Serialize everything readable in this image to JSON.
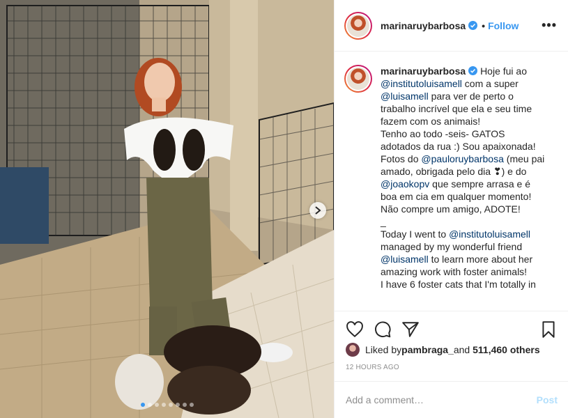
{
  "post": {
    "username": "marinaruybarbosa",
    "follow_label": "Follow",
    "separator": "•",
    "more_label": "•••"
  },
  "caption": {
    "username": "marinaruybarbosa",
    "lines": [
      [
        {
          "t": "Hoje fui ao",
          "m": false
        }
      ],
      [
        {
          "t": "@institutoluisamell",
          "m": true
        },
        {
          "t": " com a super",
          "m": false
        }
      ],
      [
        {
          "t": "@luisamell",
          "m": true
        },
        {
          "t": " para ver de perto o",
          "m": false
        }
      ],
      [
        {
          "t": "trabalho incrível que ela e seu time",
          "m": false
        }
      ],
      [
        {
          "t": "fazem com os animais!",
          "m": false
        }
      ],
      [
        {
          "t": "Tenho ao todo -seis- GATOS",
          "m": false
        }
      ],
      [
        {
          "t": "adotados da rua :) Sou apaixonada!",
          "m": false
        }
      ],
      [
        {
          "t": "Fotos do ",
          "m": false
        },
        {
          "t": "@pauloruybarbosa",
          "m": true
        },
        {
          "t": " (meu pai",
          "m": false
        }
      ],
      [
        {
          "t": "amado, obrigada pelo dia ❣) e do",
          "m": false
        }
      ],
      [
        {
          "t": "@joaokopv",
          "m": true
        },
        {
          "t": " que sempre arrasa e é",
          "m": false
        }
      ],
      [
        {
          "t": "boa em cia em qualquer momento!",
          "m": false
        }
      ],
      [
        {
          "t": "Não compre um amigo, ADOTE!",
          "m": false
        }
      ],
      [
        {
          "t": "_",
          "m": false
        }
      ],
      [
        {
          "t": " ",
          "m": false
        }
      ],
      [
        {
          "t": "Today I went to ",
          "m": false
        },
        {
          "t": "@institutoluisamell",
          "m": true
        }
      ],
      [
        {
          "t": "managed by my wonderful friend",
          "m": false
        }
      ],
      [
        {
          "t": "@luisamell",
          "m": true
        },
        {
          "t": " to learn more about her",
          "m": false
        }
      ],
      [
        {
          "t": "amazing work with foster animals!",
          "m": false
        }
      ],
      [
        {
          "t": "I have 6 foster cats that I'm totally in",
          "m": false
        }
      ]
    ]
  },
  "likes": {
    "prefix": "Liked by ",
    "user": "pambraga_",
    "middle": " and ",
    "count_text": "511,460 others"
  },
  "timestamp": "12 HOURS AGO",
  "comment": {
    "placeholder": "Add a comment…",
    "post_label": "Post"
  },
  "carousel": {
    "total_slides": 8,
    "active_index": 0
  },
  "colors": {
    "accent": "#3897f0",
    "mention": "#003569",
    "muted": "#8e8e8e",
    "post_disabled": "#b2dffc"
  },
  "icons": [
    "heart-icon",
    "comment-icon",
    "share-icon",
    "bookmark-icon",
    "verified-badge-icon",
    "more-options-icon",
    "chevron-right-icon"
  ]
}
